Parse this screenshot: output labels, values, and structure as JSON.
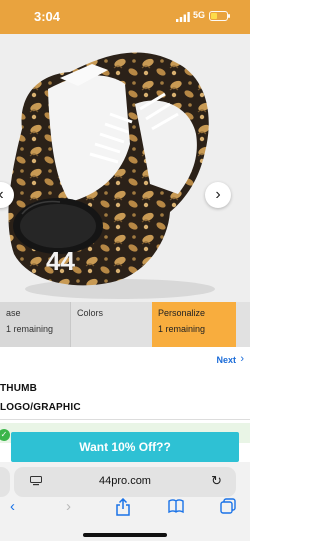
{
  "status": {
    "time": "3:04",
    "network": "5G"
  },
  "tabs": [
    {
      "title": "ase",
      "sub": "1 remaining"
    },
    {
      "title": "Colors",
      "sub": ""
    },
    {
      "title": "Personalize",
      "sub": "1 remaining"
    }
  ],
  "nav": {
    "next_label": "Next",
    "next_icon": "chevron-right-icon"
  },
  "options": [
    "THUMB",
    "LOGO/GRAPHIC"
  ],
  "offer": {
    "label": "Want 10% Off??"
  },
  "browser": {
    "url": "44pro.com"
  },
  "glove": {
    "logo_text": "44"
  },
  "colors": {
    "accent": "#f8ad3e",
    "status_bar": "#e9a33e",
    "offer": "#2ec1d4",
    "link": "#1a6bd8"
  }
}
